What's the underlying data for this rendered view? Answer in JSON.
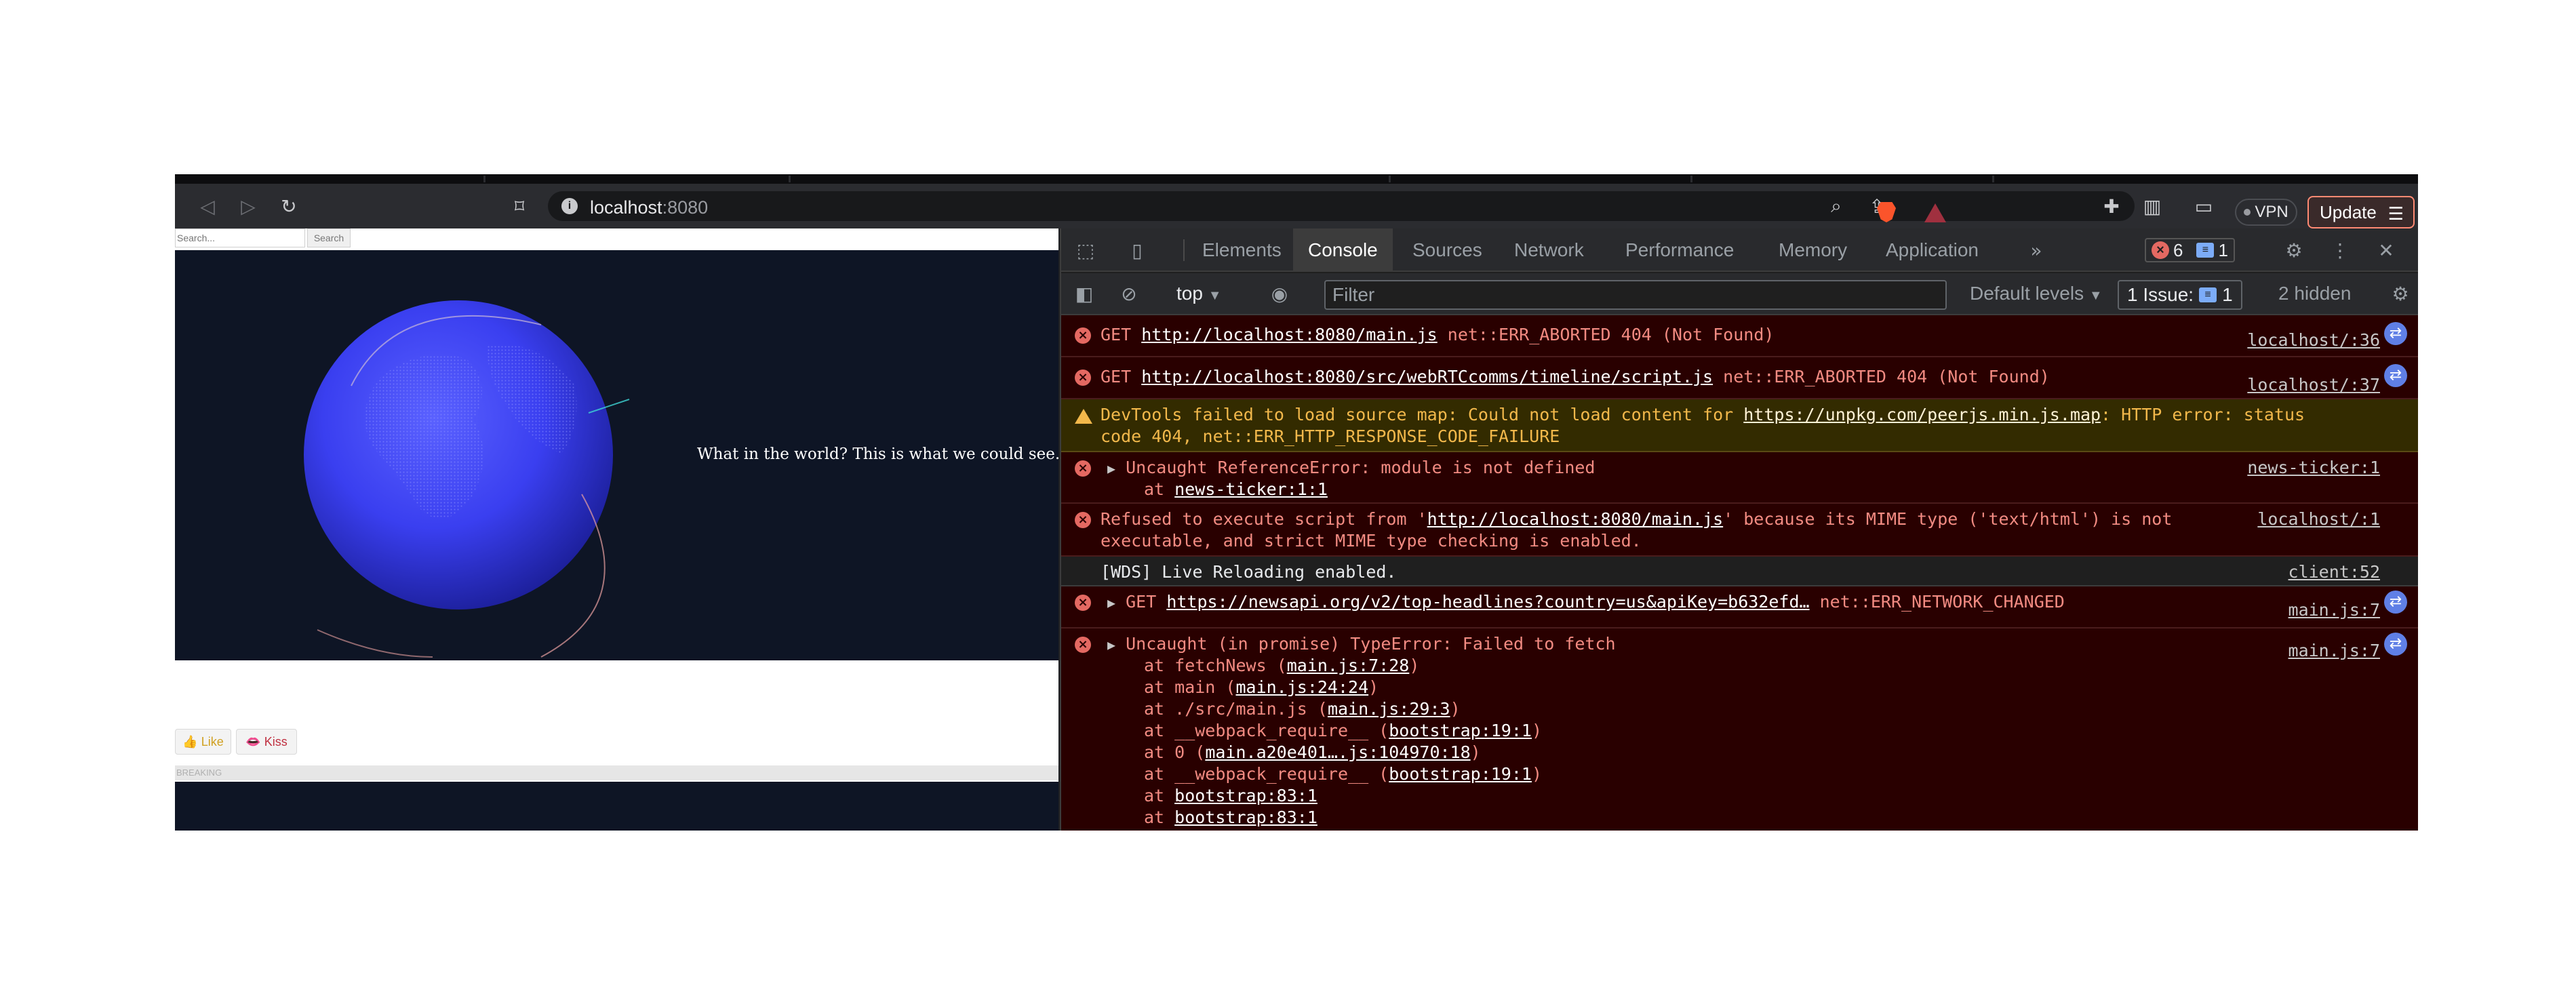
{
  "browser": {
    "url_host": "localhost",
    "url_port": ":8080",
    "vpn_label": "VPN",
    "update_label": "Update",
    "icons": [
      "back-icon",
      "forward-icon",
      "reload-icon",
      "bookmark-icon",
      "site-info-icon",
      "zoom-icon",
      "share-icon",
      "brave-shields-icon",
      "brave-rewards-icon",
      "extensions-icon",
      "sidebar-icon",
      "wallet-icon",
      "menu-icon"
    ]
  },
  "page": {
    "search_placeholder": "Search...",
    "search_button": "Search",
    "globe_caption": "What in the world? This is what we could see.",
    "reaction_1": "👍 Like",
    "reaction_2": "👄 Kiss",
    "breaking_label": "BREAKING",
    "colors": {
      "background": "#0e1525",
      "globe": "#3a3ff0"
    }
  },
  "devtools": {
    "tabs": [
      "Elements",
      "Console",
      "Sources",
      "Network",
      "Performance",
      "Memory",
      "Application"
    ],
    "active_tab": "Console",
    "error_count": "6",
    "message_count": "1",
    "context": "top",
    "filter_placeholder": "Filter",
    "levels": "Default levels",
    "issues_label": "1 Issue:",
    "issues_count": "1",
    "hidden": "2 hidden"
  },
  "console": {
    "m1": {
      "method": "GET",
      "url": "http://localhost:8080/main.js",
      "status": "net::ERR_ABORTED 404 (Not Found)",
      "source": "localhost/:36"
    },
    "m2": {
      "method": "GET",
      "url": "http://localhost:8080/src/webRTCcomms/timeline/script.js",
      "status": "net::ERR_ABORTED 404 (Not Found)",
      "source": "localhost/:37"
    },
    "m3": {
      "text": "DevTools failed to load source map: Could not load content for",
      "url": "https://unpkg.com/peerjs.min.js.map",
      "tail": ": HTTP error: status",
      "line2": "code 404, net::ERR_HTTP_RESPONSE_CODE_FAILURE"
    },
    "m4": {
      "text": "Uncaught ReferenceError: module is not defined",
      "at": "at",
      "at_link": "news-ticker:1:1",
      "source": "news-ticker:1"
    },
    "m5": {
      "pre": "Refused to execute script from '",
      "url": "http://localhost:8080/main.js",
      "post": "' because its MIME type ('text/html') is not",
      "line2": "executable, and strict MIME type checking is enabled.",
      "source": "localhost/:1"
    },
    "m6": {
      "text": "[WDS] Live Reloading enabled.",
      "source": "client:52"
    },
    "m7": {
      "method": "GET",
      "url": "https://newsapi.org/v2/top-headlines?country=us&apiKey=b632efd…",
      "status": "net::ERR_NETWORK_CHANGED",
      "source": "main.js:7"
    },
    "m8": {
      "text": "Uncaught (in promise) TypeError: Failed to fetch",
      "source": "main.js:7",
      "stack": [
        {
          "pre": "at fetchNews (",
          "link": "main.js:7:28",
          "post": ")"
        },
        {
          "pre": "at main (",
          "link": "main.js:24:24",
          "post": ")"
        },
        {
          "pre": "at ./src/main.js (",
          "link": "main.js:29:3",
          "post": ")"
        },
        {
          "pre": "at __webpack_require__ (",
          "link": "bootstrap:19:1",
          "post": ")"
        },
        {
          "pre": "at 0 (",
          "link": "main.a20e401….js:104970:18",
          "post": ")"
        },
        {
          "pre": "at __webpack_require__ (",
          "link": "bootstrap:19:1",
          "post": ")"
        },
        {
          "pre": "at ",
          "link": "bootstrap:83:1",
          "post": ""
        },
        {
          "pre": "at ",
          "link": "bootstrap:83:1",
          "post": ""
        }
      ]
    }
  }
}
